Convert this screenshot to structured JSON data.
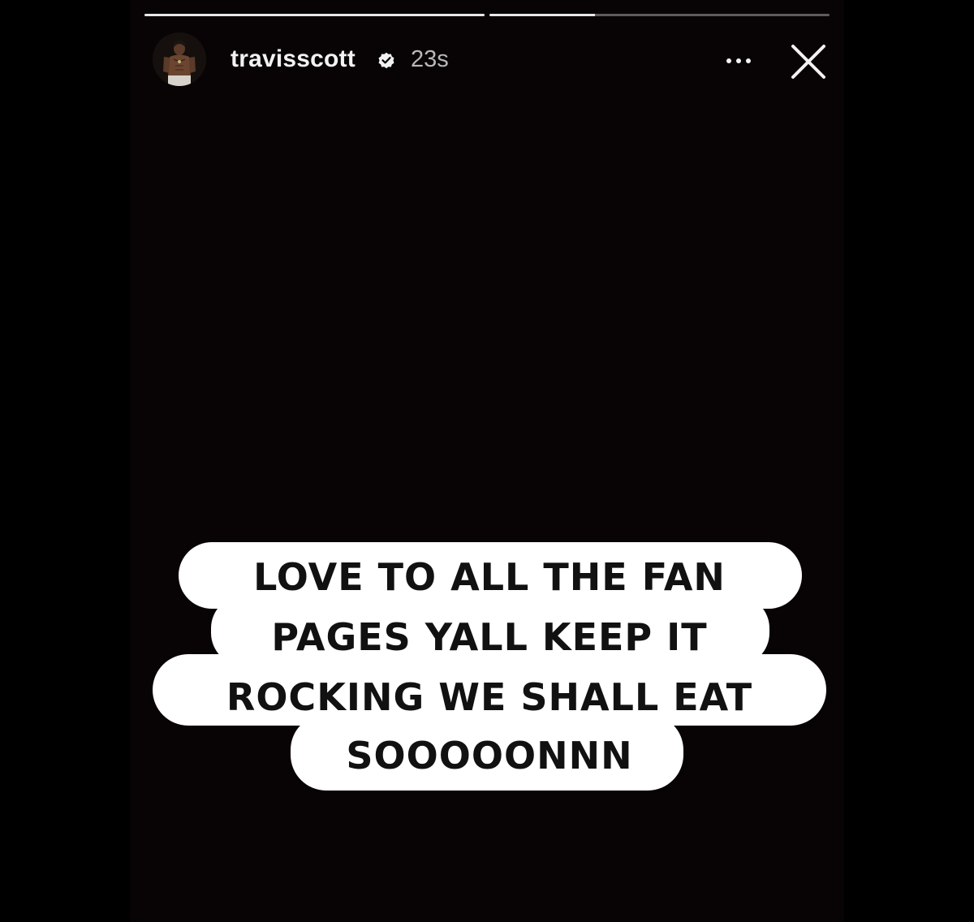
{
  "story": {
    "progress": [
      {
        "filled": 1.0
      },
      {
        "filled": 0.31
      }
    ],
    "header": {
      "username": "travisscott",
      "verified": true,
      "timestamp": "23s"
    },
    "icons": {
      "avatar": "profile-avatar",
      "verified": "verified-badge-icon",
      "more": "more-options-icon",
      "close": "close-icon"
    },
    "caption": {
      "lines": [
        "LOVE TO ALL THE FAN",
        "PAGES YALL KEEP IT",
        "ROCKING WE SHALL EAT",
        "SOOOOONNN"
      ]
    },
    "colors": {
      "background": "#080405",
      "caption_bubble": "#ffffff",
      "caption_text": "#111111",
      "username": "#f2f2f2",
      "timestamp": "#b8b8b8"
    }
  }
}
